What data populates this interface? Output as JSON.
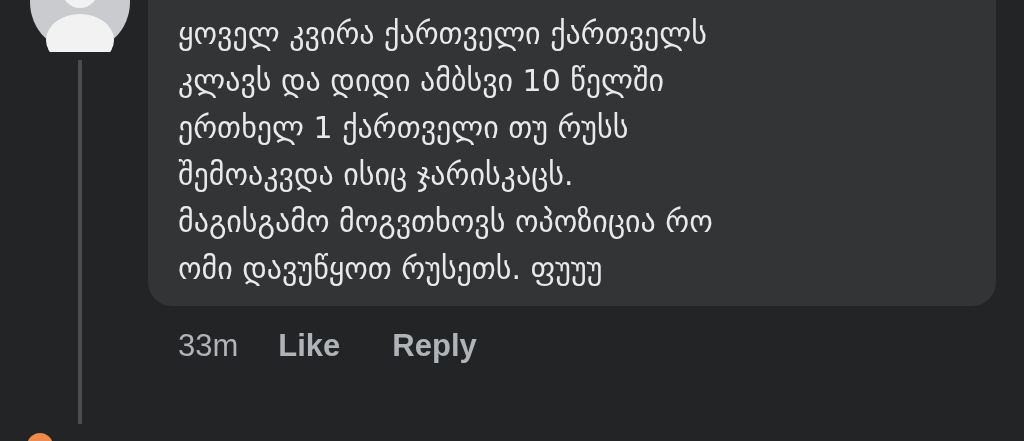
{
  "comment": {
    "text": "ყოველ კვირა ქართველი ქართველს\nკლავს და დიდი ამბსვი 10 წელში\nერთხელ 1 ქართველი თუ რუსს\nშემოაკვდა ისიც ჯარისკაცს.\nმაგისგამო მოგვთხოვს ოპოზიცია რო\nომი დავუწყოთ რუსეთს. ფუუუ",
    "time": "33m",
    "actions": [
      "Like",
      "Reply"
    ]
  }
}
